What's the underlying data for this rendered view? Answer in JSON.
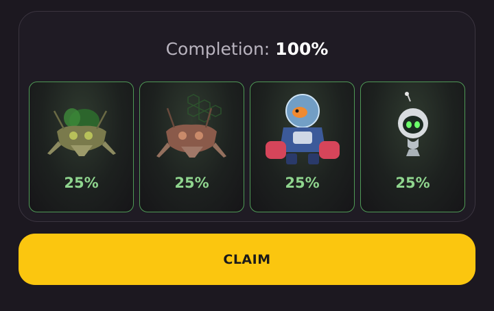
{
  "completion": {
    "label": "Completion:",
    "value": "100%"
  },
  "cards": [
    {
      "name": "green mechanical insect",
      "percent": "25%"
    },
    {
      "name": "brown mechanical insect",
      "percent": "25%"
    },
    {
      "name": "blue robot goldfish",
      "percent": "25%"
    },
    {
      "name": "round white robot drone",
      "percent": "25%"
    }
  ],
  "claim": {
    "label": "CLAIM"
  },
  "colors": {
    "accent_yellow": "#fbc60f",
    "card_border_green": "#4f9a56",
    "percent_green": "#8fd58e",
    "background": "#1c1820"
  }
}
